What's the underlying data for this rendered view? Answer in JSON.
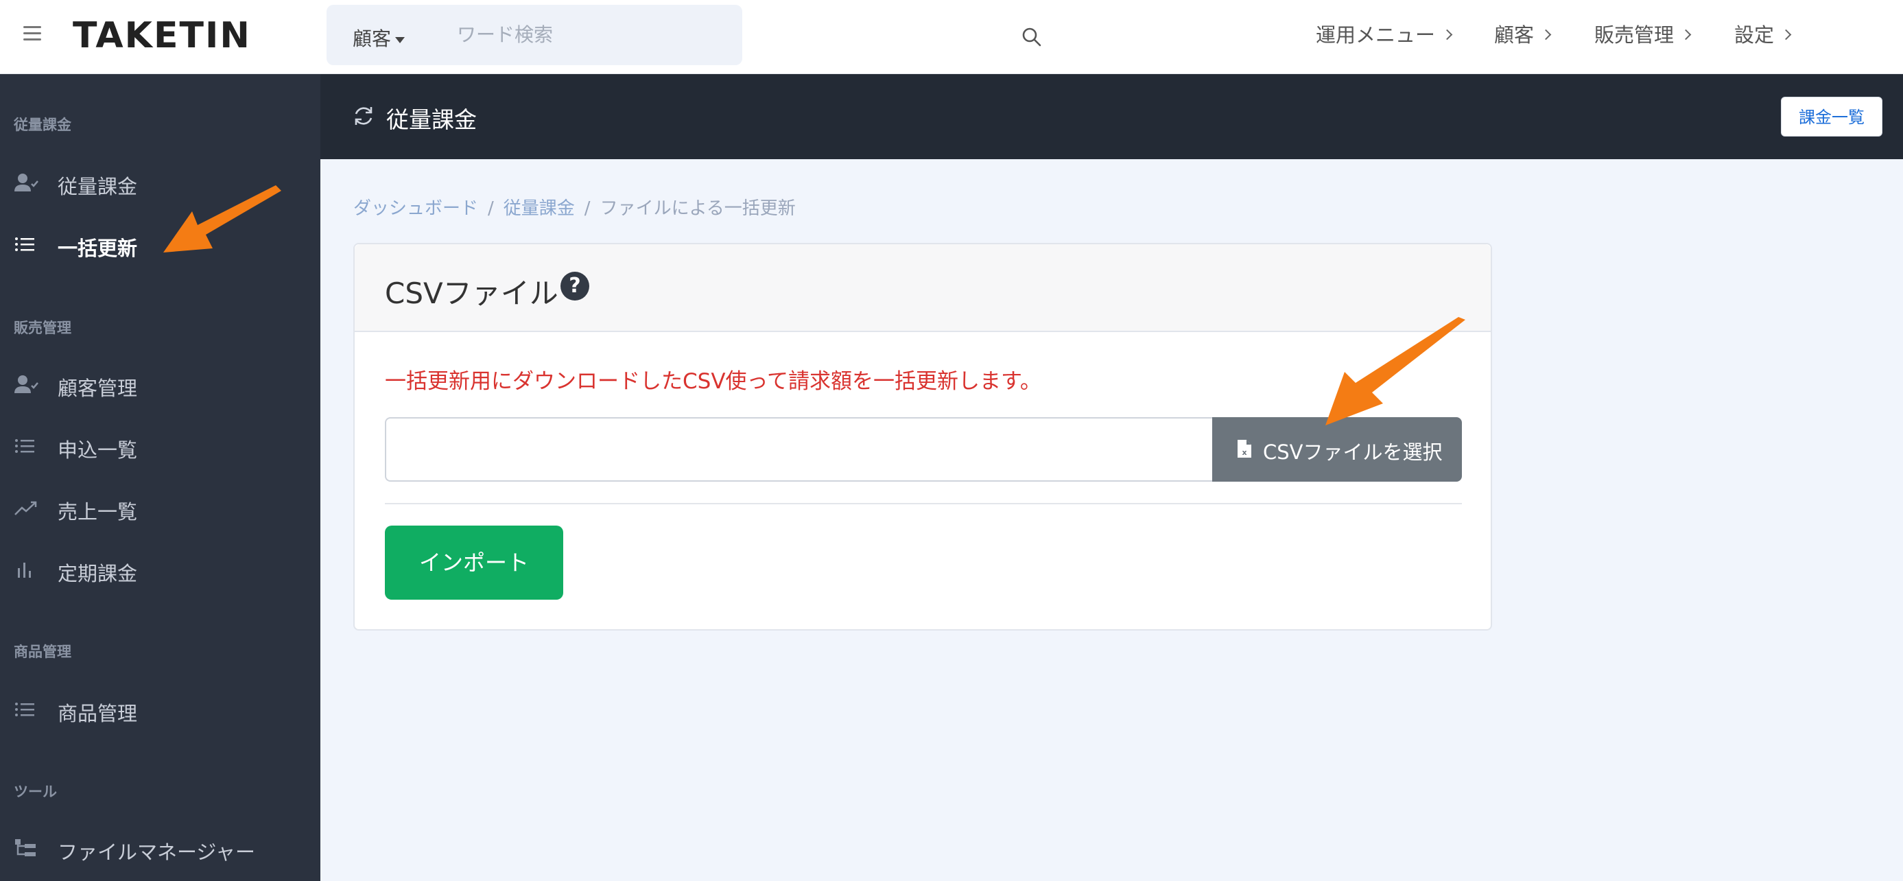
{
  "header": {
    "logo": "TAKETIN",
    "search": {
      "scope": "顧客",
      "placeholder": "ワード検索"
    },
    "nav": [
      {
        "label": "運用メニュー"
      },
      {
        "label": "顧客"
      },
      {
        "label": "販売管理"
      },
      {
        "label": "設定"
      }
    ]
  },
  "sidebar": {
    "sections": [
      {
        "title": "従量課金",
        "items": [
          {
            "label": "従量課金",
            "icon": "user-check-icon"
          },
          {
            "label": "一括更新",
            "icon": "list-icon",
            "active": true
          }
        ]
      },
      {
        "title": "販売管理",
        "items": [
          {
            "label": "顧客管理",
            "icon": "user-check-icon"
          },
          {
            "label": "申込一覧",
            "icon": "list-icon"
          },
          {
            "label": "売上一覧",
            "icon": "trend-icon"
          },
          {
            "label": "定期課金",
            "icon": "bar-chart-icon"
          }
        ]
      },
      {
        "title": "商品管理",
        "items": [
          {
            "label": "商品管理",
            "icon": "list-icon"
          }
        ]
      },
      {
        "title": "ツール",
        "items": [
          {
            "label": "ファイルマネージャー",
            "icon": "folder-tree-icon"
          }
        ]
      }
    ]
  },
  "page": {
    "title": "従量課金",
    "list_button": "課金一覧",
    "breadcrumb": [
      "ダッシュボード",
      "従量課金",
      "ファイルによる一括更新"
    ]
  },
  "card": {
    "title": "CSVファイル",
    "help": "?",
    "description": "一括更新用にダウンロードしたCSV使って請求額を一括更新します。",
    "file_button": "CSVファイルを選択",
    "file_value": "",
    "import_button": "インポート"
  },
  "colors": {
    "sidebar_bg": "#2b323f",
    "header_bg": "#232a35",
    "accent_green": "#10ad62",
    "error_red": "#d9332f",
    "annotation_orange": "#f47c14"
  }
}
